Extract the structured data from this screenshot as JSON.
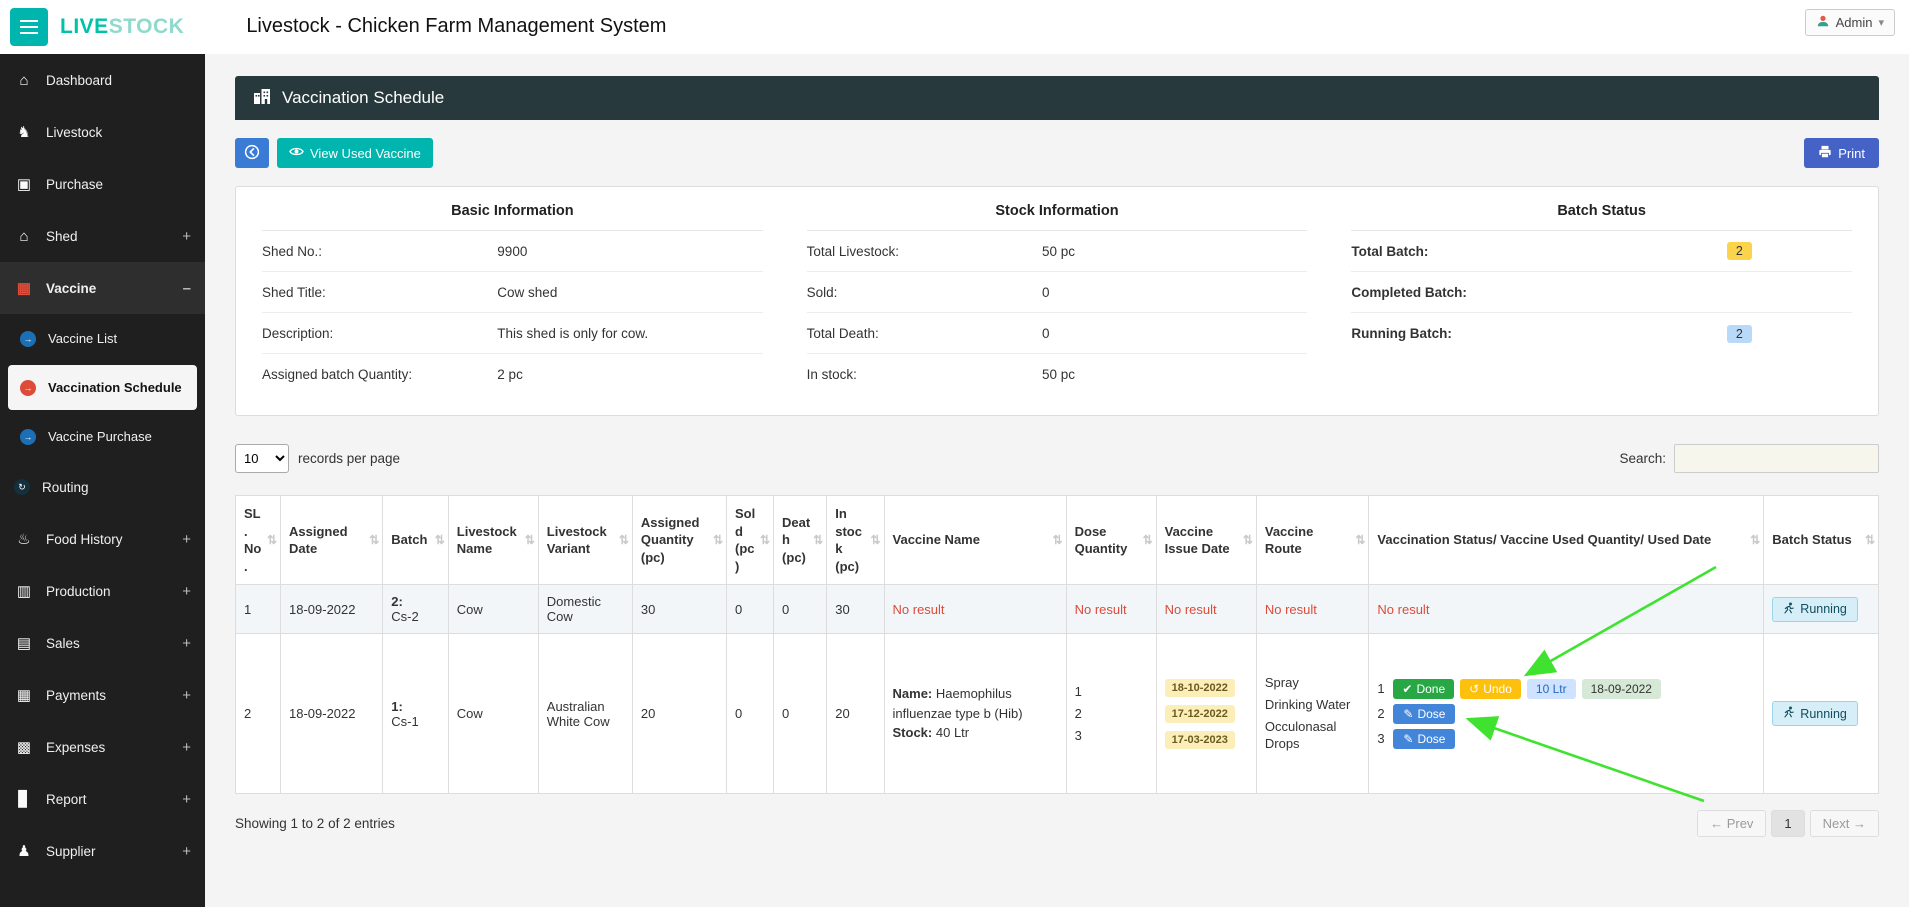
{
  "colors": {
    "teal_accent": "#00b5ad",
    "sidebar_bg": "#1f1f1f",
    "panel_header_bg": "#27393c",
    "danger_red": "#dd4b39",
    "done_green": "#28a745",
    "undo_yellow": "#fdc10d",
    "dose_blue": "#4285d9",
    "print_blue": "#4562c7",
    "running_bg": "#d5eef7",
    "annotation_arrow_green": "#3fe32f"
  },
  "icons": {
    "sort": "⇅",
    "check": "✔",
    "undo": "↺",
    "pencil": "✎",
    "caret": "▾"
  },
  "topbar": {
    "logo_live": "LIVE",
    "logo_stock": "STOCK",
    "title": "Livestock - Chicken Farm Management System",
    "admin_label": "Admin"
  },
  "sidebar": {
    "items": [
      {
        "label": "Dashboard",
        "glyph": "⌂"
      },
      {
        "label": "Livestock",
        "glyph": "♞"
      },
      {
        "label": "Purchase",
        "glyph": "▣"
      },
      {
        "label": "Shed",
        "glyph": "⌂",
        "expander": "+"
      },
      {
        "label": "Vaccine",
        "glyph": "▦",
        "expander": "–"
      },
      {
        "label": "Vaccine List",
        "glyph": "→"
      },
      {
        "label": "Vaccination Schedule",
        "glyph": "→"
      },
      {
        "label": "Vaccine Purchase",
        "glyph": "→"
      },
      {
        "label": "Routing",
        "glyph": "↻"
      },
      {
        "label": "Food History",
        "glyph": "♨",
        "expander": "+"
      },
      {
        "label": "Production",
        "glyph": "▥",
        "expander": "+"
      },
      {
        "label": "Sales",
        "glyph": "▤",
        "expander": "+"
      },
      {
        "label": "Payments",
        "glyph": "▦",
        "expander": "+"
      },
      {
        "label": "Expenses",
        "glyph": "▩",
        "expander": "+"
      },
      {
        "label": "Report",
        "glyph": "▊",
        "expander": "+"
      },
      {
        "label": "Supplier",
        "glyph": "♟",
        "expander": "+"
      }
    ]
  },
  "panel": {
    "title": "Vaccination Schedule",
    "view_used_vaccine": "View Used Vaccine",
    "print_label": "Print"
  },
  "info": {
    "basic": {
      "title": "Basic Information",
      "rows": [
        {
          "label": "Shed No.:",
          "value": "9900"
        },
        {
          "label": "Shed Title:",
          "value": "Cow shed"
        },
        {
          "label": "Description:",
          "value": "This shed is only for cow."
        },
        {
          "label": "Assigned batch Quantity:",
          "value": "2 pc"
        }
      ]
    },
    "stock": {
      "title": "Stock Information",
      "rows": [
        {
          "label": "Total Livestock:",
          "value": "50 pc"
        },
        {
          "label": "Sold:",
          "value": "0"
        },
        {
          "label": "Total Death:",
          "value": "0"
        },
        {
          "label": "In stock:",
          "value": "50 pc"
        }
      ]
    },
    "batch": {
      "title": "Batch Status",
      "rows": [
        {
          "label": "Total Batch:",
          "value": "2"
        },
        {
          "label": "Completed Batch:",
          "value": ""
        },
        {
          "label": "Running Batch:",
          "value": "2"
        }
      ]
    }
  },
  "controls": {
    "per_page": "10",
    "records_label": "records per page",
    "search_label": "Search:"
  },
  "table": {
    "headers": [
      "SL. No.",
      "Assigned Date",
      "Batch",
      "Livestock Name",
      "Livestock Variant",
      "Assigned Quantity (pc)",
      "Sold (pc)",
      "Death (pc)",
      "In stock (pc)",
      "Vaccine Name",
      "Dose Quantity",
      "Vaccine Issue Date",
      "Vaccine Route",
      "Vaccination Status/ Vaccine Used Quantity/ Used Date",
      "Batch Status"
    ],
    "no_result": "No result",
    "row1": {
      "sl": "1",
      "assigned_date": "18-09-2022",
      "batch_no": "2:",
      "batch_code": "Cs-2",
      "livestock_name": "Cow",
      "livestock_variant": "Domestic Cow",
      "assigned_qty": "30",
      "sold": "0",
      "death": "0",
      "in_stock": "30",
      "batch_status": "Running"
    },
    "row2": {
      "sl": "2",
      "assigned_date": "18-09-2022",
      "batch_no": "1:",
      "batch_code": "Cs-1",
      "livestock_name": "Cow",
      "livestock_variant": "Australian White Cow",
      "assigned_qty": "20",
      "sold": "0",
      "death": "0",
      "in_stock": "20",
      "vaccine_name_label": "Name:",
      "vaccine_name": "Haemophilus influenzae type b (Hib)",
      "stock_label": "Stock:",
      "stock_value": "40 Ltr",
      "doses": [
        "1",
        "2",
        "3"
      ],
      "issue_dates": [
        "18-10-2022",
        "17-12-2022",
        "17-03-2023"
      ],
      "routes": [
        "Spray",
        "Drinking Water",
        "Occulonasal Drops"
      ],
      "status": {
        "line1": {
          "num": "1",
          "done": "Done",
          "undo": "Undo",
          "used_qty": "10 Ltr",
          "used_date": "18-09-2022"
        },
        "line2": {
          "num": "2",
          "dose": "Dose"
        },
        "line3": {
          "num": "3",
          "dose": "Dose"
        }
      },
      "batch_status": "Running"
    }
  },
  "footer": {
    "showing": "Showing 1 to 2 of 2 entries",
    "prev": "← Prev",
    "page": "1",
    "next": "Next →"
  }
}
